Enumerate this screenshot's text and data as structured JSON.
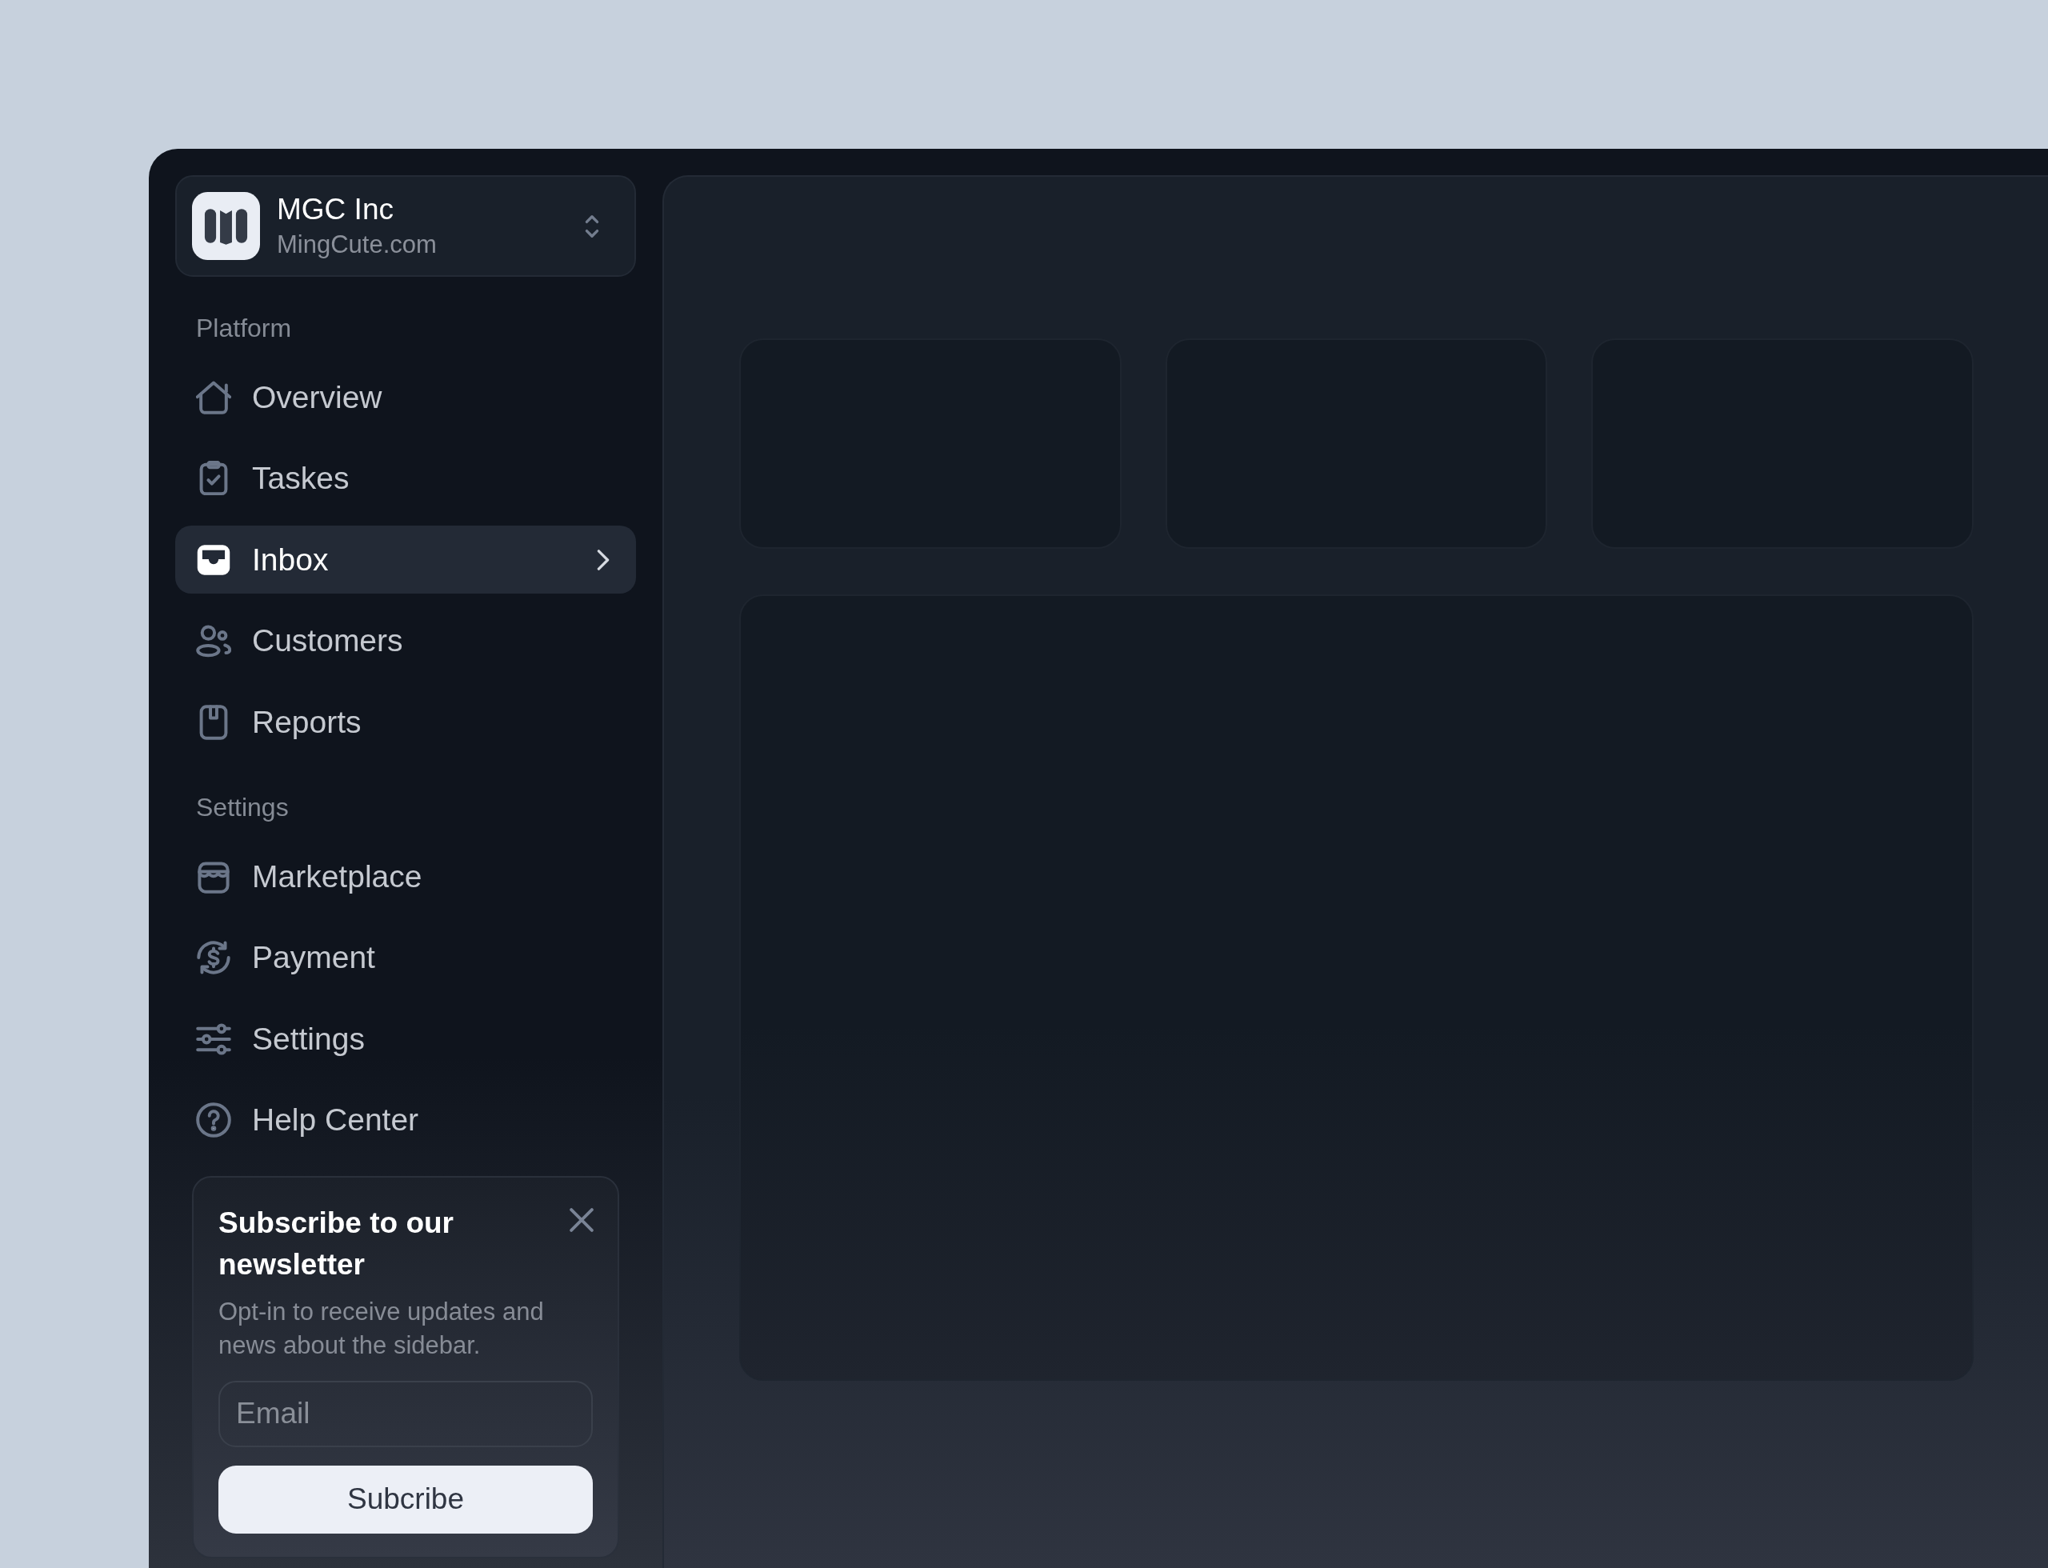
{
  "workspace": {
    "name": "MGC Inc",
    "domain": "MingCute.com"
  },
  "nav_sections": [
    {
      "label": "Platform",
      "items": [
        {
          "label": "Overview",
          "selected": false
        },
        {
          "label": "Taskes",
          "selected": false
        },
        {
          "label": "Inbox",
          "selected": true
        },
        {
          "label": "Customers",
          "selected": false
        },
        {
          "label": "Reports",
          "selected": false
        }
      ]
    },
    {
      "label": "Settings",
      "items": [
        {
          "label": "Marketplace",
          "selected": false
        },
        {
          "label": "Payment",
          "selected": false
        },
        {
          "label": "Settings",
          "selected": false
        },
        {
          "label": "Help Center",
          "selected": false
        }
      ]
    }
  ],
  "newsletter": {
    "title": "Subscribe to our newsletter",
    "description": "Opt-in to receive updates and news about the sidebar.",
    "email_field": {
      "placeholder": "Email"
    },
    "button": "Subcribe"
  }
}
